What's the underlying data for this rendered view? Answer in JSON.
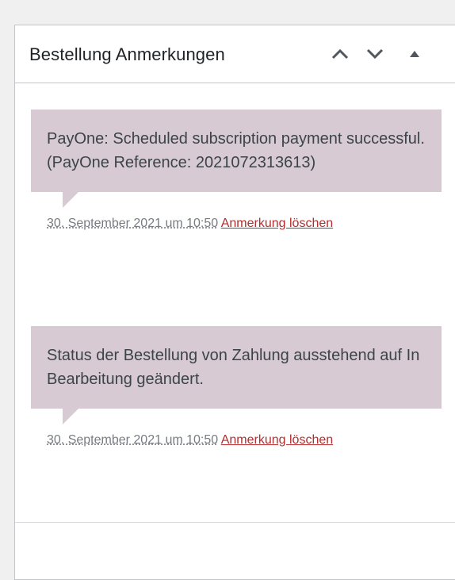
{
  "header": {
    "title": "Bestellung Anmerkungen"
  },
  "notes": [
    {
      "content": "PayOne: Scheduled subscription payment successful. (PayOne Reference: 2021072313613)",
      "date": "30. September 2021 um 10:50",
      "delete_label": "Anmerkung löschen"
    },
    {
      "content": "Status der Bestellung von Zahlung ausstehend auf In Bearbeitung geändert.",
      "date": "30. September 2021 um 10:50",
      "delete_label": "Anmerkung löschen"
    }
  ],
  "icons": {
    "move_up": "chevron-up-icon",
    "move_down": "chevron-down-icon",
    "toggle": "triangle-up-icon"
  },
  "colors": {
    "note_background": "#d7cad2",
    "delete_link": "#b32d2e",
    "meta_text": "#787c82",
    "title_text": "#1d2327"
  }
}
